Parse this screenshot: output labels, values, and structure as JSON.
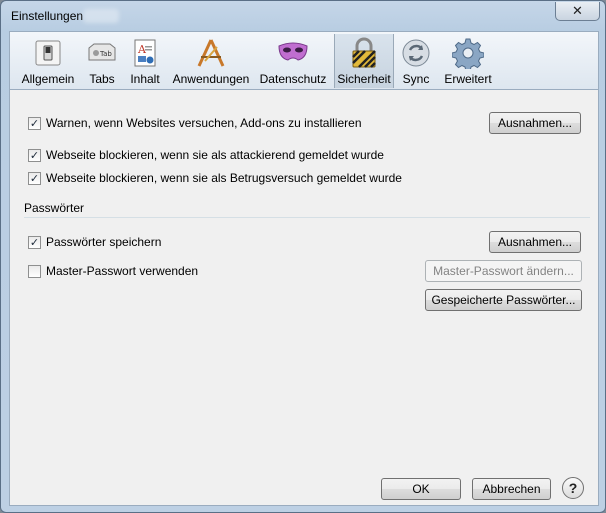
{
  "window": {
    "title": "Einstellungen",
    "close_glyph": "✕"
  },
  "toolbar": {
    "items": [
      {
        "label": "Allgemein",
        "icon": "switch-icon"
      },
      {
        "label": "Tabs",
        "icon": "tab-icon"
      },
      {
        "label": "Inhalt",
        "icon": "document-icon"
      },
      {
        "label": "Anwendungen",
        "icon": "applications-icon"
      },
      {
        "label": "Datenschutz",
        "icon": "mask-icon"
      },
      {
        "label": "Sicherheit",
        "icon": "padlock-icon",
        "selected": true
      },
      {
        "label": "Sync",
        "icon": "sync-icon"
      },
      {
        "label": "Erweitert",
        "icon": "gear-icon"
      }
    ],
    "tab_icon_text": "Tab"
  },
  "security": {
    "warn_addons": {
      "label": "Warnen, wenn Websites versuchen, Add-ons zu installieren",
      "checked": true
    },
    "exceptions_button": "Ausnahmen...",
    "block_attack": {
      "label": "Webseite blockieren, wenn sie als attackierend gemeldet wurde",
      "checked": true
    },
    "block_forgery": {
      "label": "Webseite blockieren, wenn sie als Betrugsversuch gemeldet wurde",
      "checked": true
    }
  },
  "passwords": {
    "group_title": "Passwörter",
    "save_passwords": {
      "label": "Passwörter speichern",
      "checked": true
    },
    "exceptions_button": "Ausnahmen...",
    "master_password": {
      "label": "Master-Passwort verwenden",
      "checked": false
    },
    "change_master_button": "Master-Passwort ändern...",
    "saved_passwords_button": "Gespeicherte Passwörter..."
  },
  "footer": {
    "ok": "OK",
    "cancel": "Abbrechen",
    "help": "?"
  },
  "checkmark": "✓",
  "colors": {
    "selected_tab": "#c7d3df",
    "title_bar": "#bdd0e4"
  }
}
